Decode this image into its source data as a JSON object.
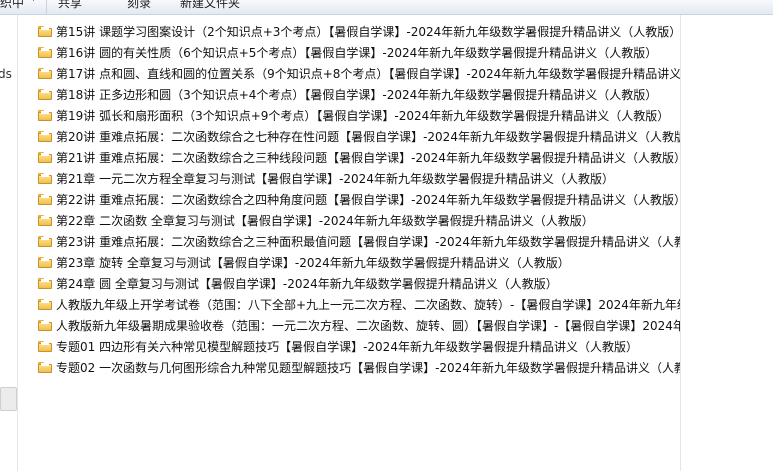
{
  "toolbar": {
    "organize": "织中",
    "share": "共享",
    "burn": "刻录",
    "new_folder": "新建文件夹"
  },
  "nav": {
    "partial_text": "ds"
  },
  "files": [
    "第15讲 课题学习图案设计（2个知识点+3个考点）【暑假自学课】-2024年新九年级数学暑假提升精品讲义（人教版）",
    "第16讲 圆的有关性质（6个知识点+5个考点）【暑假自学课】-2024年新九年级数学暑假提升精品讲义（人教版）",
    "第17讲 点和圆、直线和圆的位置关系（9个知识点+8个考点）【暑假自学课】-2024年新九年级数学暑假提升精品讲义",
    "第18讲 正多边形和圆（3个知识点+4个考点）【暑假自学课】-2024年新九年级数学暑假提升精品讲义（人教版）",
    "第19讲 弧长和扇形面积（3个知识点+9个考点）【暑假自学课】-2024年新九年级数学暑假提升精品讲义（人教版）",
    "第20讲 重难点拓展：二次函数综合之七种存在性问题【暑假自学课】-2024年新九年级数学暑假提升精品讲义（人教版",
    "第21讲 重难点拓展：二次函数综合之三种线段问题【暑假自学课】-2024年新九年级数学暑假提升精品讲义（人教版）",
    "第21章 一元二次方程全章复习与测试【暑假自学课】-2024年新九年级数学暑假提升精品讲义（人教版）",
    "第22讲 重难点拓展：二次函数综合之四种角度问题【暑假自学课】-2024年新九年级数学暑假提升精品讲义（人教版）",
    "第22章 二次函数 全章复习与测试【暑假自学课】-2024年新九年级数学暑假提升精品讲义（人教版）",
    "第23讲 重难点拓展：二次函数综合之三种面积最值问题【暑假自学课】-2024年新九年级数学暑假提升精品讲义（人教",
    "第23章 旋转 全章复习与测试【暑假自学课】-2024年新九年级数学暑假提升精品讲义（人教版）",
    "第24章 圆 全章复习与测试【暑假自学课】-2024年新九年级数学暑假提升精品讲义（人教版）",
    "人教版九年级上开学考试卷（范围：八下全部+九上一元二次方程、二次函数、旋转）-【暑假自学课】2024年新九年级",
    "人教版新九年级暑期成果验收卷（范围：一元二次方程、二次函数、旋转、圆）【暑假自学课】-【暑假自学课】2024年",
    "专题01 四边形有关六种常见模型解题技巧【暑假自学课】-2024年新九年级数学暑假提升精品讲义（人教版）",
    "专题02 一次函数与几何图形综合九种常见题型解题技巧【暑假自学课】-2024年新九年级数学暑假提升精品讲义（人教版"
  ]
}
